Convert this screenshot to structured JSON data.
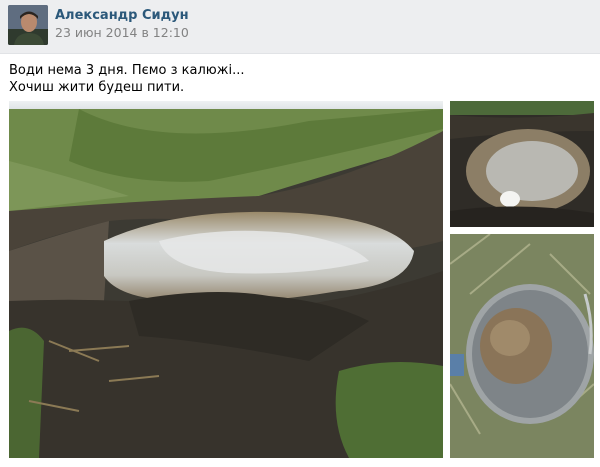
{
  "post": {
    "author_name": "Александр Сидун",
    "date": "23 июн 2014 в 12:10",
    "text_lines": [
      "Води нема 3 дня. Пємо з калюжі...",
      "Хочиш жити будеш пити."
    ]
  },
  "photos": [
    {
      "subject": "muddy puddle in field"
    },
    {
      "subject": "puddle close-up"
    },
    {
      "subject": "metal bucket with muddy water"
    }
  ],
  "colors": {
    "header_bg": "#edeef0",
    "author_link": "#2b587a",
    "date_text": "#828282"
  }
}
